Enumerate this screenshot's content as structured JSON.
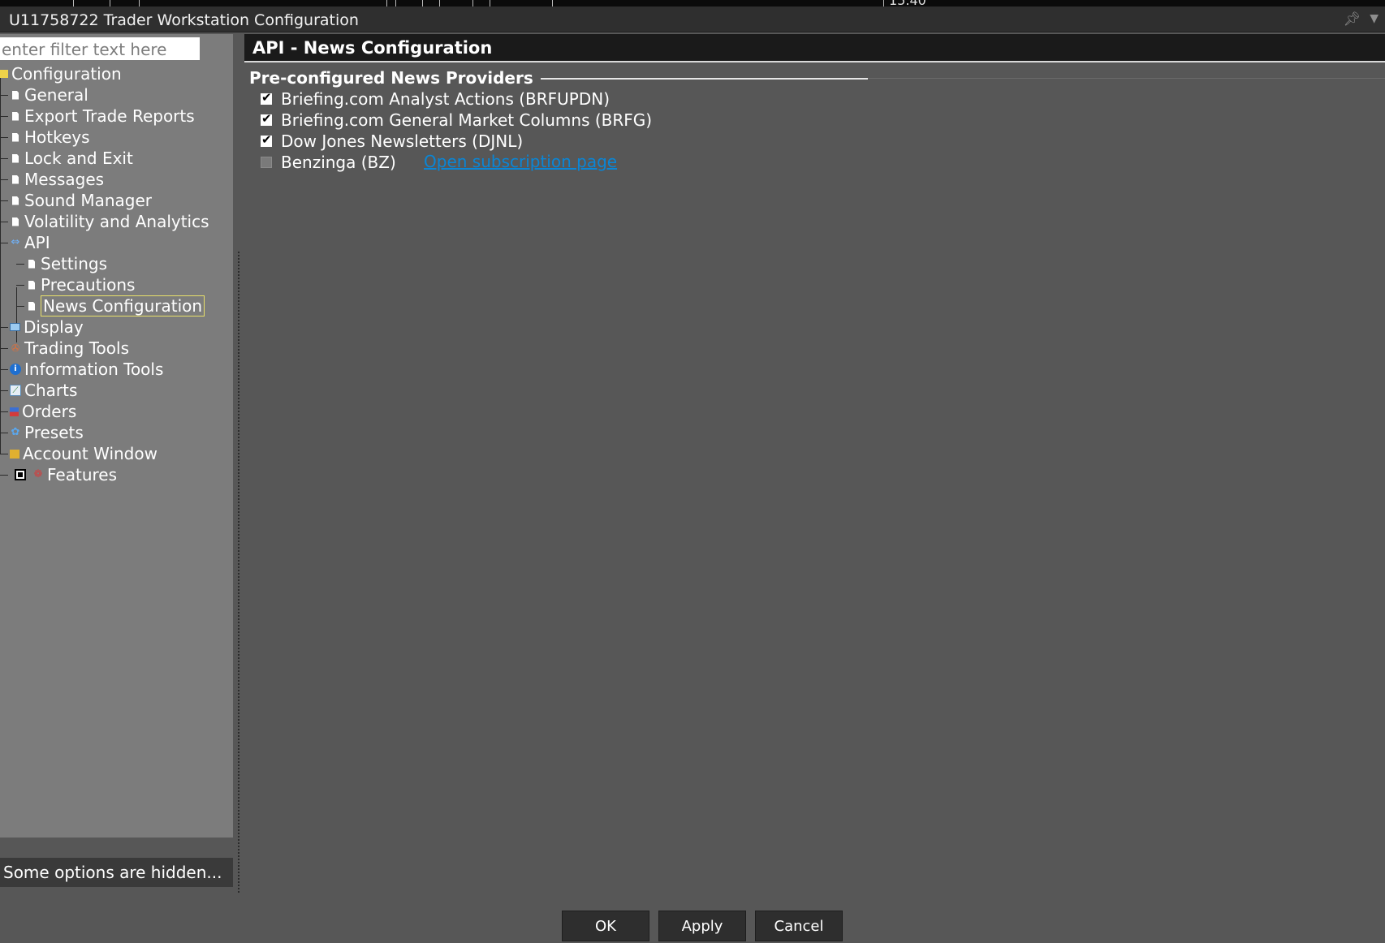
{
  "window": {
    "title": "U11758722 Trader Workstation Configuration",
    "top_readout": "15.40"
  },
  "filter": {
    "placeholder": "enter filter text here"
  },
  "tree": {
    "root": "Configuration",
    "items": {
      "general": "General",
      "export": "Export Trade Reports",
      "hotkeys": "Hotkeys",
      "lock": "Lock and Exit",
      "messages": "Messages",
      "sound": "Sound Manager",
      "volatility": "Volatility and Analytics",
      "api": "API",
      "api_settings": "Settings",
      "api_precautions": "Precautions",
      "api_news": "News Configuration",
      "display": "Display",
      "trading_tools": "Trading Tools",
      "information_tools": "Information Tools",
      "charts": "Charts",
      "orders": "Orders",
      "presets": "Presets",
      "account_window": "Account Window",
      "features": "Features"
    },
    "hidden_note": "Some options are hidden..."
  },
  "main": {
    "header": "API - News Configuration",
    "group_title": "Pre-configured News Providers",
    "providers": [
      {
        "label": "Briefing.com Analyst Actions (BRFUPDN)",
        "checked": true
      },
      {
        "label": "Briefing.com General Market Columns (BRFG)",
        "checked": true
      },
      {
        "label": "Dow Jones Newsletters (DJNL)",
        "checked": true
      },
      {
        "label": "Benzinga (BZ)",
        "checked": false
      }
    ],
    "subscription_link": "Open subscription page"
  },
  "buttons": {
    "ok": "OK",
    "apply": "Apply",
    "cancel": "Cancel"
  },
  "colors": {
    "link": "#0a86d6",
    "panel": "#7c7c7c",
    "background": "#575757",
    "header": "#1a1a1a"
  }
}
